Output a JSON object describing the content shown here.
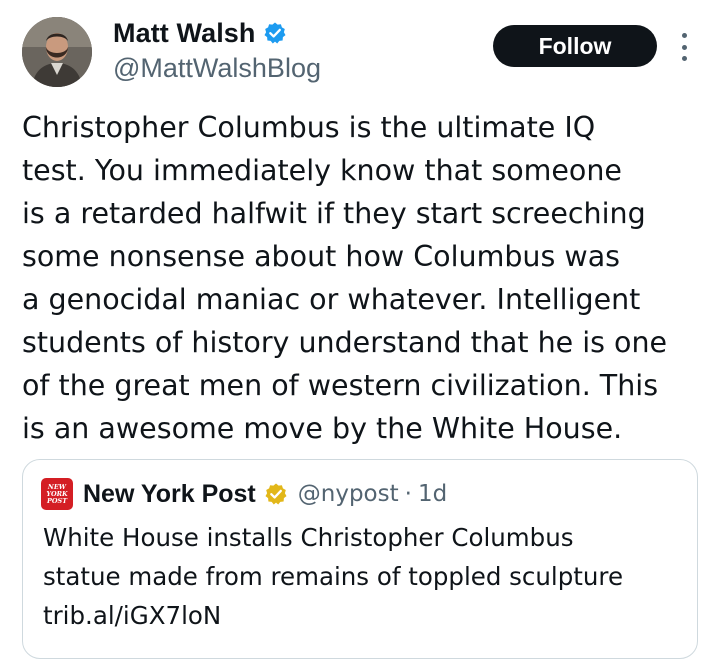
{
  "author": {
    "display_name": "Matt Walsh",
    "handle": "@MattWalshBlog",
    "verified_badge": "blue-verified-icon",
    "avatar_icon": "avatar-photo"
  },
  "actions": {
    "follow_label": "Follow",
    "more_icon": "more-vertical-icon"
  },
  "tweet": {
    "lines": [
      "Christopher Columbus is the ultimate IQ",
      "test. You immediately know that someone",
      "is a retarded halfwit if they start screeching",
      "some nonsense about how Columbus was",
      "a genocidal maniac or whatever. Intelligent",
      "students of history understand that he is one",
      "of the great men of western civilization. This",
      "is an awesome move by the White House."
    ]
  },
  "quote": {
    "logo_text": [
      "NEW",
      "YORK",
      "POST"
    ],
    "name": "New York Post",
    "verified_badge": "gold-verified-icon",
    "handle": "@nypost",
    "separator": "·",
    "time": "1d",
    "lines": [
      "White House installs Christopher Columbus",
      "statue made from remains of toppled sculpture",
      "trib.al/iGX7loN"
    ]
  },
  "colors": {
    "text": "#0f1419",
    "secondary": "#536471",
    "verified_blue": "#1d9bf0",
    "verified_gold": "#e2b719",
    "nyp_red": "#d41e24",
    "border": "#cfd9de"
  }
}
